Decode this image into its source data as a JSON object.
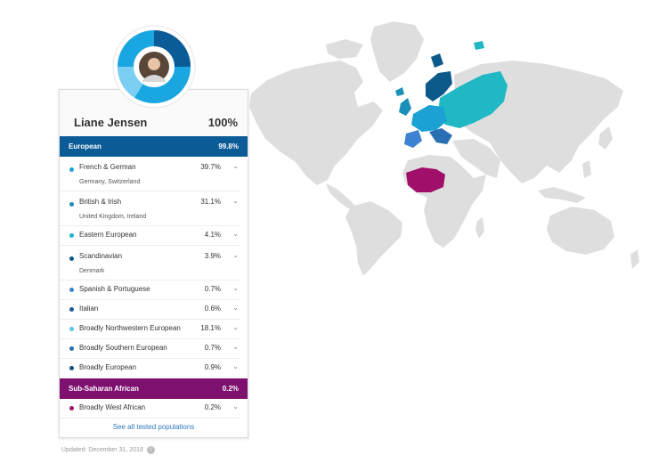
{
  "person": {
    "name": "Liane Jensen",
    "total": "100%"
  },
  "colors": {
    "european": "#0b5b96",
    "sub_saharan": "#7e1070",
    "map_land": "#dedede",
    "donut_main": "#1aa6e0",
    "donut_dark": "#0b5b96",
    "donut_light": "#7bcff2"
  },
  "groups": [
    {
      "label": "European",
      "percent": "99.8%",
      "populations": [
        {
          "name": "French & German",
          "percent": "39.7%",
          "subregions": "Germany, Switzerland",
          "color": "#1ba1d4"
        },
        {
          "name": "British & Irish",
          "percent": "31.1%",
          "subregions": "United Kingdom, Ireland",
          "color": "#1a8fb7"
        },
        {
          "name": "Eastern European",
          "percent": "4.1%",
          "subregions": "",
          "color": "#1fb3c6"
        },
        {
          "name": "Scandinavian",
          "percent": "3.9%",
          "subregions": "Denmark",
          "color": "#0d5a8a"
        },
        {
          "name": "Spanish & Portuguese",
          "percent": "0.7%",
          "subregions": "",
          "color": "#3d83d2"
        },
        {
          "name": "Italian",
          "percent": "0.6%",
          "subregions": "",
          "color": "#1c5a96"
        },
        {
          "name": "Broadly Northwestern European",
          "percent": "18.1%",
          "subregions": "",
          "color": "#5bc4ea"
        },
        {
          "name": "Broadly Southern European",
          "percent": "0.7%",
          "subregions": "",
          "color": "#2a6eb3"
        },
        {
          "name": "Broadly European",
          "percent": "0.9%",
          "subregions": "",
          "color": "#134f7c"
        }
      ]
    },
    {
      "label": "Sub-Saharan African",
      "percent": "0.2%",
      "populations": [
        {
          "name": "Broadly West African",
          "percent": "0.2%",
          "subregions": "",
          "color": "#a0106b"
        }
      ]
    }
  ],
  "see_all_label": "See all tested populations",
  "updated_label": "Updated: December 31, 2018",
  "icons": {
    "expand": "chevron-down-icon",
    "info": "info-icon",
    "avatar": "avatar"
  }
}
